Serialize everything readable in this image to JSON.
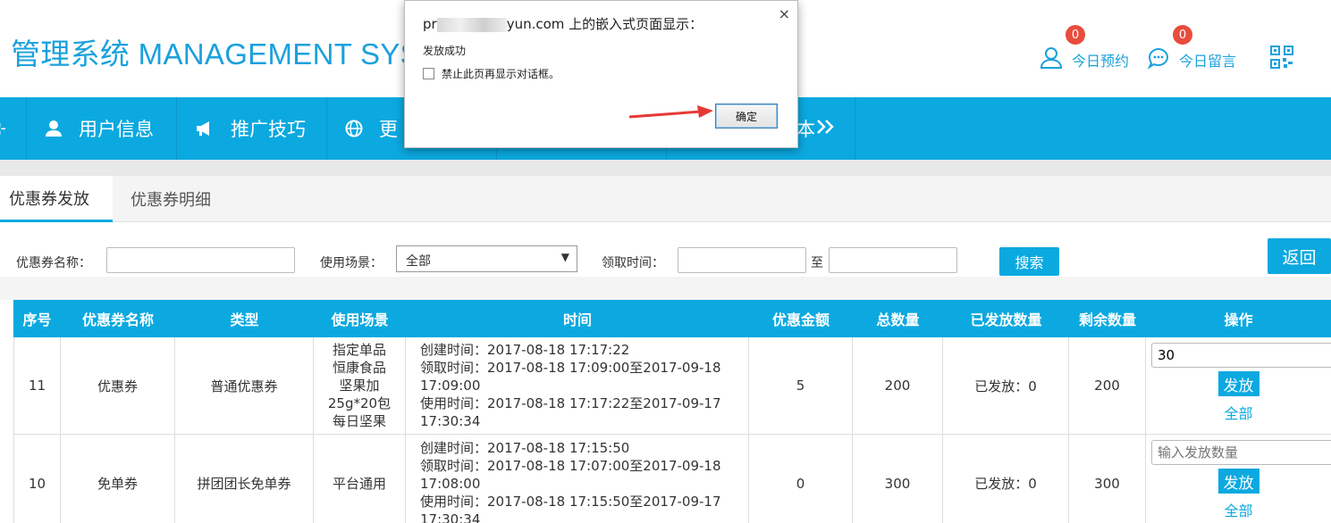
{
  "header": {
    "logo": "管理系统 MANAGEMENT SYS",
    "reservations": {
      "label": "今日预约",
      "count": "0"
    },
    "messages": {
      "label": "今日留言",
      "count": "0"
    },
    "brand_color": "#1ba1dc"
  },
  "nav": {
    "items": [
      {
        "label": "用户信息",
        "icon": "user-icon"
      },
      {
        "label": "推广技巧",
        "icon": "megaphone-icon"
      },
      {
        "label": "更",
        "icon": "globe-icon"
      },
      {
        "label": "本",
        "icon": "double-chevron-right-icon"
      }
    ],
    "color": "#0ba9e0"
  },
  "tabs": [
    {
      "label": "优惠券发放",
      "active": true
    },
    {
      "label": "优惠券明细",
      "active": false
    }
  ],
  "filter": {
    "name_label": "优惠券名称：",
    "scene_label": "使用场景：",
    "scene_value": "全部",
    "time_label": "领取时间：",
    "to_label": "至",
    "search_label": "搜索",
    "back_label": "返回"
  },
  "table": {
    "headers": [
      "序号",
      "优惠券名称",
      "类型",
      "使用场景",
      "时间",
      "优惠金额",
      "总数量",
      "已发放数量",
      "剩余数量",
      "操作"
    ],
    "rows": [
      {
        "id": "11",
        "name": "优惠券",
        "type": "普通优惠券",
        "scene": "指定单品\n恒康食品\n坚果加\n25g*20包\n每日坚果",
        "created": "创建时间：2017-08-18 17:17:22",
        "receive": "领取时间：2017-08-18 17:09:00至2017-09-18 17:09:00",
        "use": "使用时间：2017-08-18 17:17:22至2017-09-17 17:30:34",
        "amount": "5",
        "total": "200",
        "issued": "已发放：0",
        "remaining": "200",
        "qty_value": "30",
        "qty_placeholder": "",
        "send_label": "发放",
        "all_label": "全部"
      },
      {
        "id": "10",
        "name": "免单券",
        "type": "拼团团长免单券",
        "scene": "平台通用",
        "created": "创建时间：2017-08-18 17:15:50",
        "receive": "领取时间：2017-08-18 17:07:00至2017-09-18 17:08:00",
        "use": "使用时间：2017-08-18 17:15:50至2017-09-17 17:30:34",
        "amount": "0",
        "total": "300",
        "issued": "已发放：0",
        "remaining": "300",
        "qty_value": "",
        "qty_placeholder": "输入发放数量",
        "send_label": "发放",
        "all_label": "全部"
      }
    ]
  },
  "dialog": {
    "title_prefix": "pr",
    "title_suffix": "yun.com 上的嵌入式页面显示：",
    "message": "发放成功",
    "checkbox_label": "禁止此页再显示对话框。",
    "ok_label": "确定",
    "close_glyph": "×",
    "arrow_color": "#e53935"
  }
}
